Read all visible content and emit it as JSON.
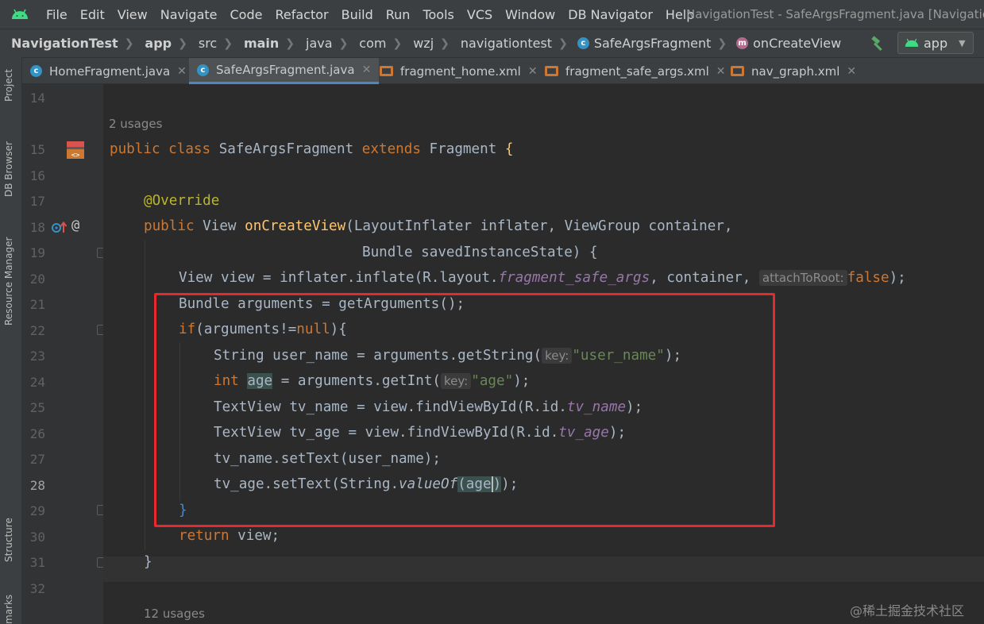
{
  "menubar": {
    "items": [
      "File",
      "Edit",
      "View",
      "Navigate",
      "Code",
      "Refactor",
      "Build",
      "Run",
      "Tools",
      "VCS",
      "Window",
      "DB Navigator",
      "Help"
    ],
    "window_title": "NavigationTest - SafeArgsFragment.java [Navigatio"
  },
  "navbar": {
    "crumbs": [
      "NavigationTest",
      "app",
      "src",
      "main",
      "java",
      "com",
      "wzj",
      "navigationtest",
      "SafeArgsFragment",
      "onCreateView"
    ],
    "run_config": "app"
  },
  "toolstripe": {
    "tabs": [
      "Project",
      "DB Browser",
      "Resource Manager",
      "Structure",
      "marks"
    ]
  },
  "tabs": [
    {
      "label": "HomeFragment.java",
      "type": "java",
      "active": false
    },
    {
      "label": "SafeArgsFragment.java",
      "type": "java",
      "active": true
    },
    {
      "label": "fragment_home.xml",
      "type": "xml",
      "active": false
    },
    {
      "label": "fragment_safe_args.xml",
      "type": "xml",
      "active": false
    },
    {
      "label": "nav_graph.xml",
      "type": "xml",
      "active": false
    }
  ],
  "gutter": {
    "line_numbers": [
      "14",
      "15",
      "16",
      "17",
      "18",
      "19",
      "20",
      "21",
      "22",
      "23",
      "24",
      "25",
      "26",
      "27",
      "28",
      "29",
      "30",
      "31",
      "32"
    ],
    "current_line": "28"
  },
  "editor": {
    "usage_hint_1": "2 usages",
    "usage_hint_2": "12 usages",
    "line15": {
      "kw1": "public",
      "kw2": "class",
      "name": "SafeArgsFragment",
      "kw3": "extends",
      "parent": "Fragment",
      "brace": "{"
    },
    "line17": {
      "annotation": "@Override"
    },
    "line18": {
      "kw": "public",
      "type": "View",
      "method": "onCreateView",
      "params": "(LayoutInflater inflater, ViewGroup container,"
    },
    "line19": {
      "params": "Bundle savedInstanceState) {"
    },
    "line20": {
      "pre": "View view = inflater.inflate(R.layout.",
      "field": "fragment_safe_args",
      "mid": ", container, ",
      "hint": "attachToRoot:",
      "kw": "false",
      "post": ");"
    },
    "line21": {
      "text": "Bundle arguments = getArguments();"
    },
    "line22": {
      "kw": "if",
      "pre": "(arguments!=",
      "null": "null",
      "post": "){"
    },
    "line23": {
      "pre": "String user_name = arguments.getString(",
      "hint": "key:",
      "str": "\"user_name\"",
      "post": ");"
    },
    "line24": {
      "kw": "int",
      "var": "age",
      "pre": " = arguments.getInt(",
      "hint": "key:",
      "str": "\"age\"",
      "post": ");"
    },
    "line25": {
      "pre": "TextView tv_name = view.findViewById(R.id.",
      "field": "tv_name",
      "post": ");"
    },
    "line26": {
      "pre": "TextView tv_age = view.findViewById(R.id.",
      "field": "tv_age",
      "post": ");"
    },
    "line27": {
      "text": "tv_name.setText(user_name);"
    },
    "line28": {
      "pre": "tv_age.setText(String.",
      "method": "valueOf",
      "open": "(",
      "arg": "age",
      "close": ")",
      "post": ");"
    },
    "line29": {
      "text": "}"
    },
    "line30": {
      "kw": "return",
      "post": " view;"
    },
    "line31": {
      "text": "}"
    }
  },
  "watermark": "@稀土掘金技术社区",
  "colors": {
    "background": "#2b2b2b",
    "keyword": "#cc7832",
    "method": "#ffc66d",
    "string": "#6a8759",
    "field": "#9876aa",
    "highlight_box": "#e8282d"
  }
}
